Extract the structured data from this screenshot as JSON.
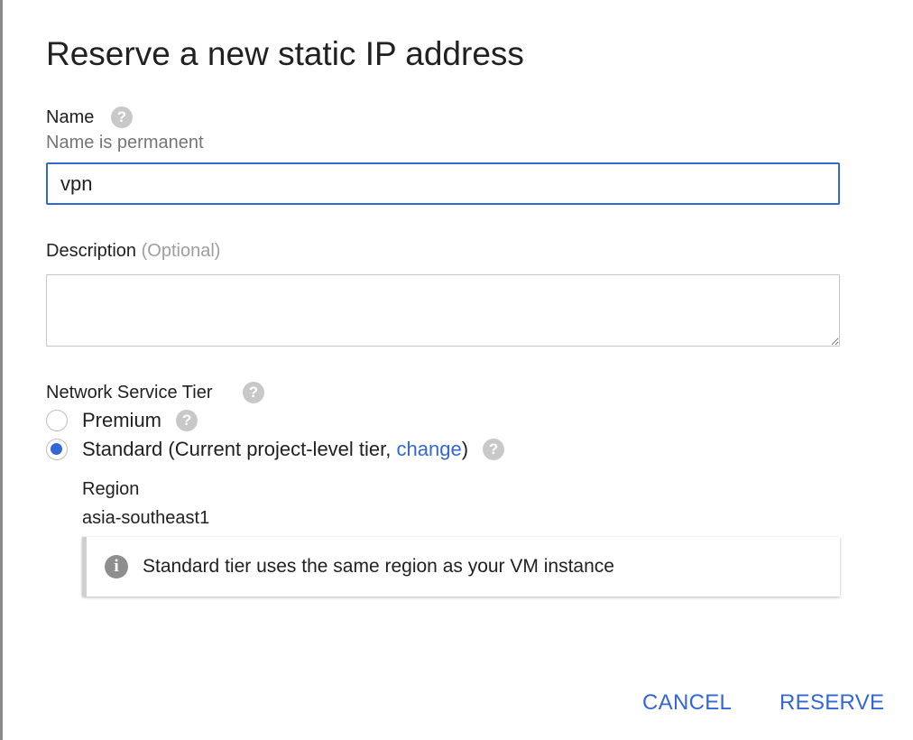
{
  "dialog": {
    "title": "Reserve a new static IP address"
  },
  "name_field": {
    "label": "Name",
    "help_icon": "help-icon",
    "hint": "Name is permanent",
    "value": "vpn"
  },
  "description_field": {
    "label": "Description",
    "optional_label": "(Optional)",
    "value": ""
  },
  "network_tier": {
    "label": "Network Service Tier",
    "help_icon": "help-icon",
    "options": [
      {
        "label": "Premium",
        "checked": false
      },
      {
        "label": "Standard (Current project-level tier,",
        "link_text": "change",
        "suffix": ")",
        "checked": true
      }
    ]
  },
  "region": {
    "label": "Region",
    "value": "asia-southeast1"
  },
  "info_box": {
    "icon": "info-icon",
    "text": "Standard tier uses the same region as your VM instance"
  },
  "actions": {
    "cancel_label": "CANCEL",
    "reserve_label": "RESERVE"
  },
  "colors": {
    "accent": "#3367d6",
    "help_icon": "#c8c8c8",
    "muted_text": "#757575"
  }
}
